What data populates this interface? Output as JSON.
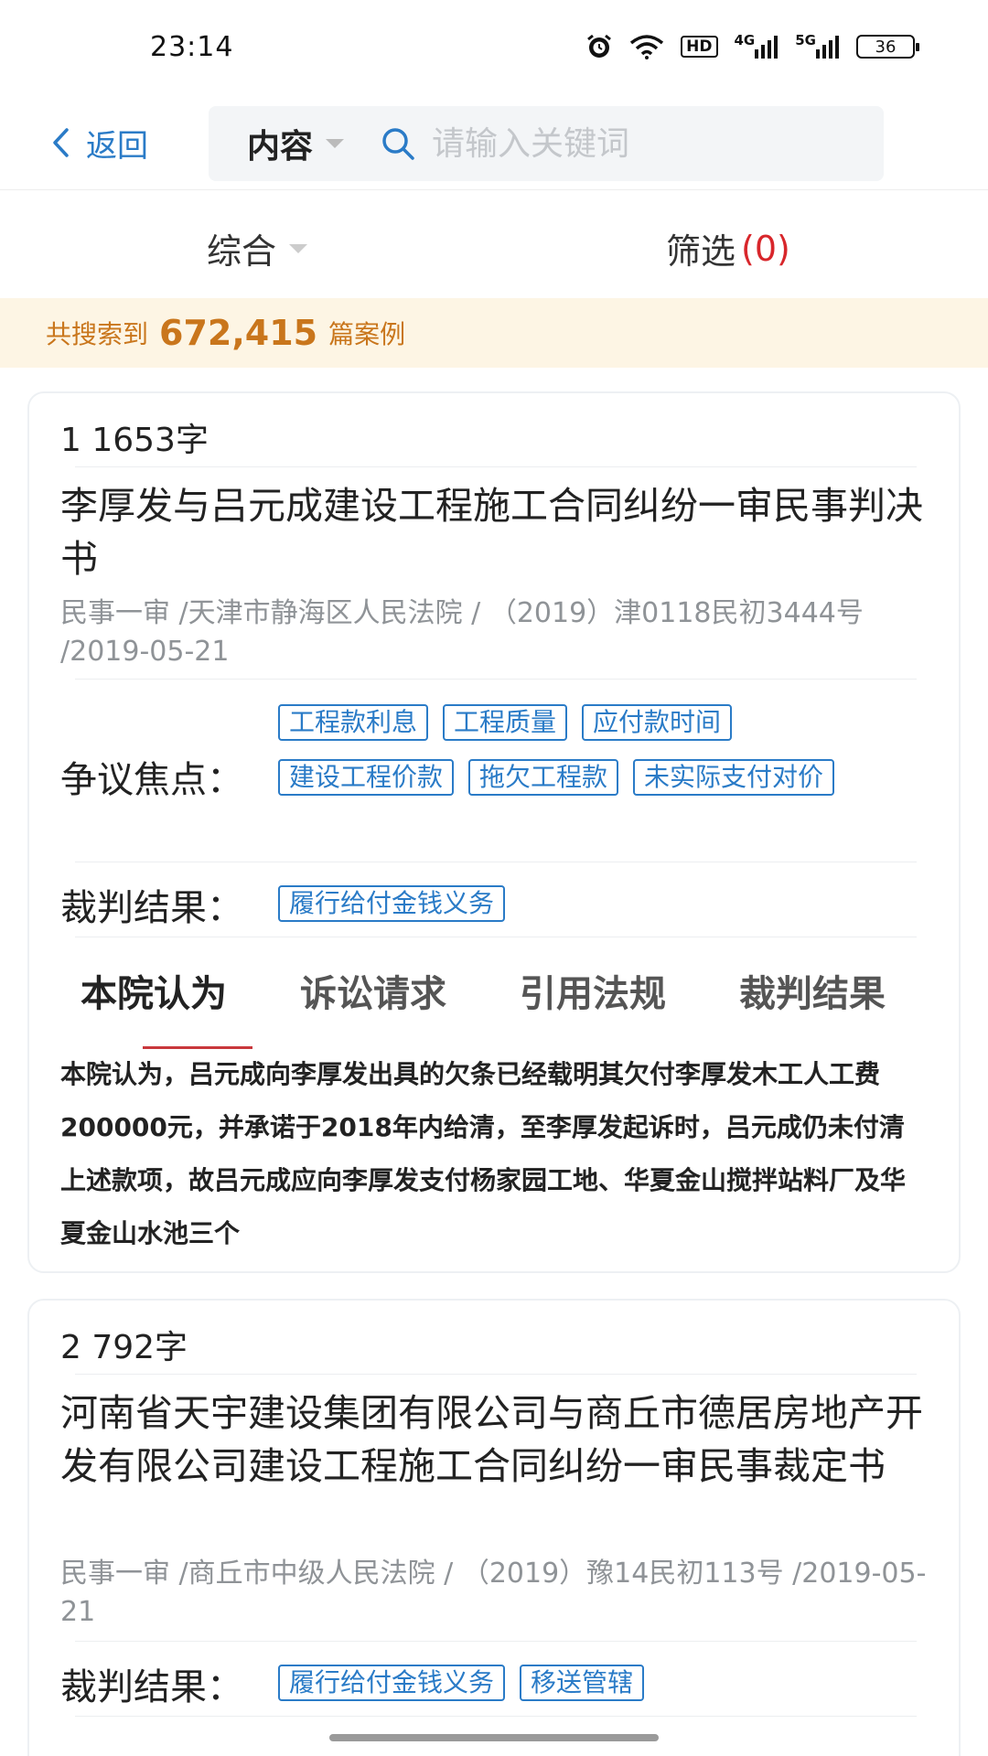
{
  "status_bar": {
    "time": "23:14",
    "icons": [
      "alarm-icon",
      "wifi-icon",
      "hd-icon",
      "signal-4g-icon",
      "signal-5g-icon",
      "battery-icon"
    ],
    "hd_label": "HD",
    "net1": "4G",
    "net2": "5G",
    "battery": "36"
  },
  "nav": {
    "back_label": "返回",
    "scope_label": "内容",
    "search_placeholder": "请输入关键词"
  },
  "sort": {
    "sort_label": "综合",
    "filter_label": "筛选",
    "filter_count": "(0)"
  },
  "banner": {
    "prefix": "共搜索到",
    "count": "672,415",
    "suffix": "篇案例"
  },
  "colors": {
    "accent": "#2a7bc7",
    "banner_bg": "#fdf5e4",
    "banner_text": "#c9761c",
    "filter_count": "#d8262b",
    "tab_underline": "#c9383c"
  },
  "results": [
    {
      "head": "1  1653字",
      "title": "李厚发与吕元成建设工程施工合同纠纷一审民事判决书",
      "meta": "民事一审 /天津市静海区人民法院 / （2019）津0118民初3444号 /2019-05-21",
      "focus_label": "争议焦点：",
      "focus_tags": [
        "工程款利息",
        "工程质量",
        "应付款时间",
        "建设工程价款",
        "拖欠工程款",
        "未实际支付对价"
      ],
      "result_label": "裁判结果：",
      "result_tags": [
        "履行给付金钱义务"
      ],
      "tabs": [
        "本院认为",
        "诉讼请求",
        "引用法规",
        "裁判结果"
      ],
      "active_tab": 0,
      "excerpt": "本院认为，吕元成向李厚发出具的欠条已经载明其欠付李厚发木工人工费200000元，并承诺于2018年内给清，至李厚发起诉时，吕元成仍未付清上述款项，故吕元成应向李厚发支付杨家园工地、华夏金山搅拌站料厂及华夏金山水池三个"
    },
    {
      "head": "2  792字",
      "title": "河南省天宇建设集团有限公司与商丘市德居房地产开发有限公司建设工程施工合同纠纷一审民事裁定书",
      "meta": "民事一审 /商丘市中级人民法院 / （2019）豫14民初113号 /2019-05-21",
      "result_label": "裁判结果：",
      "result_tags": [
        "履行给付金钱义务",
        "移送管辖"
      ]
    }
  ]
}
